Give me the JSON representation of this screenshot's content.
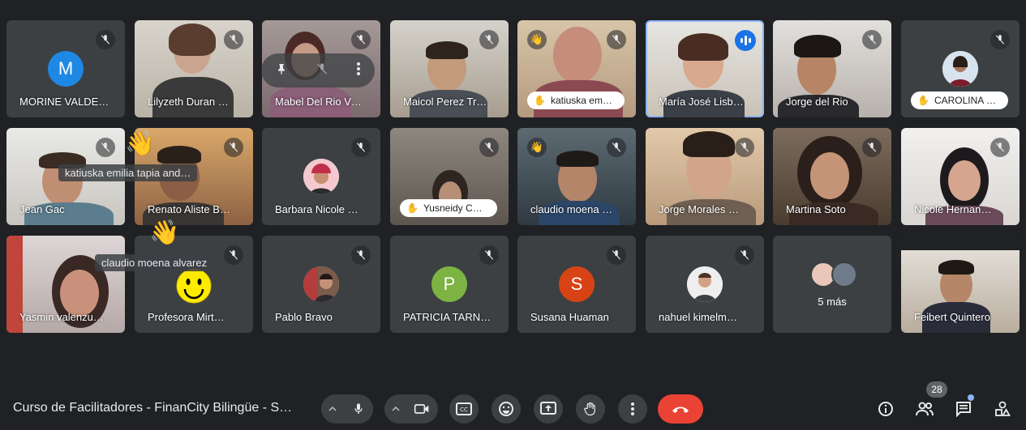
{
  "participants": [
    {
      "name": "MORINE VALDE…"
    },
    {
      "name": "Lilyzeth Duran …"
    },
    {
      "name": "Mabel Del Rio V…"
    },
    {
      "name": "Maicol Perez Tr…"
    },
    {
      "name": "katiuska em…",
      "hand_label": "katiuska em…"
    },
    {
      "name": "María José Lisb…"
    },
    {
      "name": "Jorge del Rio"
    },
    {
      "name": "CAROLINA …",
      "hand_label": "CAROLINA …"
    },
    {
      "name": "Jean Gac"
    },
    {
      "name": "Renato Aliste B…"
    },
    {
      "name": "Barbara Nicole …"
    },
    {
      "name": "Yusneidy C…",
      "hand_label": "Yusneidy C…"
    },
    {
      "name": "claudio moena …"
    },
    {
      "name": "Jorge Morales …"
    },
    {
      "name": "Martina Soto"
    },
    {
      "name": "Nicole Hernan…"
    },
    {
      "name": "Yasmin valenzu…"
    },
    {
      "name": "Profesora Mirt…"
    },
    {
      "name": "Pablo Bravo"
    },
    {
      "name": "PATRICIA TARN…"
    },
    {
      "name": "Susana Huaman"
    },
    {
      "name": "nahuel kimelm…"
    },
    {
      "name": "5 más"
    },
    {
      "name": "Feibert Quintero"
    }
  ],
  "avatar_letters": {
    "morine": "M",
    "patricia": "P",
    "susana": "S"
  },
  "tooltips": {
    "katiuska": "katiuska emilia tapia and…",
    "claudio": "claudio moena alvarez"
  },
  "meeting": {
    "title": "Curso de Facilitadores - FinanCity Bilingüe - S…",
    "participant_count": "28"
  },
  "colors": {
    "background": "#202124",
    "tile": "#3c4043",
    "leave": "#ea4335",
    "speaking": "#1a73e8",
    "avatar_morine": "#1e88e5",
    "avatar_patricia": "#7cb342",
    "avatar_susana": "#d84315"
  }
}
